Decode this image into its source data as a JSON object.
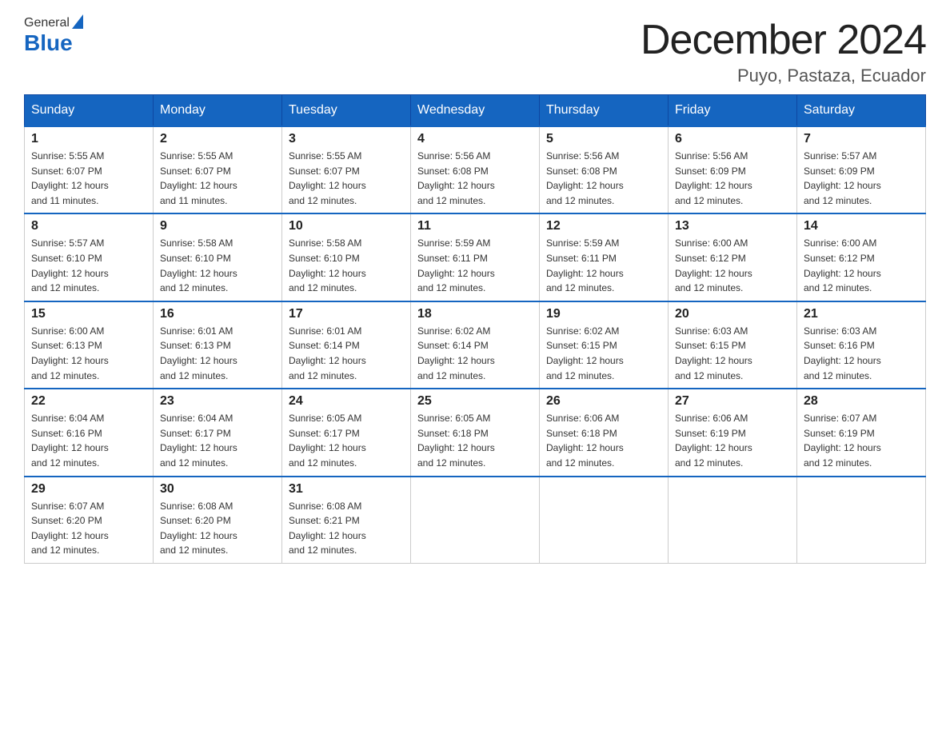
{
  "logo": {
    "general": "General",
    "blue": "Blue"
  },
  "title": "December 2024",
  "location": "Puyo, Pastaza, Ecuador",
  "days_of_week": [
    "Sunday",
    "Monday",
    "Tuesday",
    "Wednesday",
    "Thursday",
    "Friday",
    "Saturday"
  ],
  "weeks": [
    [
      {
        "day": "1",
        "sunrise": "5:55 AM",
        "sunset": "6:07 PM",
        "daylight": "12 hours and 11 minutes."
      },
      {
        "day": "2",
        "sunrise": "5:55 AM",
        "sunset": "6:07 PM",
        "daylight": "12 hours and 11 minutes."
      },
      {
        "day": "3",
        "sunrise": "5:55 AM",
        "sunset": "6:07 PM",
        "daylight": "12 hours and 12 minutes."
      },
      {
        "day": "4",
        "sunrise": "5:56 AM",
        "sunset": "6:08 PM",
        "daylight": "12 hours and 12 minutes."
      },
      {
        "day": "5",
        "sunrise": "5:56 AM",
        "sunset": "6:08 PM",
        "daylight": "12 hours and 12 minutes."
      },
      {
        "day": "6",
        "sunrise": "5:56 AM",
        "sunset": "6:09 PM",
        "daylight": "12 hours and 12 minutes."
      },
      {
        "day": "7",
        "sunrise": "5:57 AM",
        "sunset": "6:09 PM",
        "daylight": "12 hours and 12 minutes."
      }
    ],
    [
      {
        "day": "8",
        "sunrise": "5:57 AM",
        "sunset": "6:10 PM",
        "daylight": "12 hours and 12 minutes."
      },
      {
        "day": "9",
        "sunrise": "5:58 AM",
        "sunset": "6:10 PM",
        "daylight": "12 hours and 12 minutes."
      },
      {
        "day": "10",
        "sunrise": "5:58 AM",
        "sunset": "6:10 PM",
        "daylight": "12 hours and 12 minutes."
      },
      {
        "day": "11",
        "sunrise": "5:59 AM",
        "sunset": "6:11 PM",
        "daylight": "12 hours and 12 minutes."
      },
      {
        "day": "12",
        "sunrise": "5:59 AM",
        "sunset": "6:11 PM",
        "daylight": "12 hours and 12 minutes."
      },
      {
        "day": "13",
        "sunrise": "6:00 AM",
        "sunset": "6:12 PM",
        "daylight": "12 hours and 12 minutes."
      },
      {
        "day": "14",
        "sunrise": "6:00 AM",
        "sunset": "6:12 PM",
        "daylight": "12 hours and 12 minutes."
      }
    ],
    [
      {
        "day": "15",
        "sunrise": "6:00 AM",
        "sunset": "6:13 PM",
        "daylight": "12 hours and 12 minutes."
      },
      {
        "day": "16",
        "sunrise": "6:01 AM",
        "sunset": "6:13 PM",
        "daylight": "12 hours and 12 minutes."
      },
      {
        "day": "17",
        "sunrise": "6:01 AM",
        "sunset": "6:14 PM",
        "daylight": "12 hours and 12 minutes."
      },
      {
        "day": "18",
        "sunrise": "6:02 AM",
        "sunset": "6:14 PM",
        "daylight": "12 hours and 12 minutes."
      },
      {
        "day": "19",
        "sunrise": "6:02 AM",
        "sunset": "6:15 PM",
        "daylight": "12 hours and 12 minutes."
      },
      {
        "day": "20",
        "sunrise": "6:03 AM",
        "sunset": "6:15 PM",
        "daylight": "12 hours and 12 minutes."
      },
      {
        "day": "21",
        "sunrise": "6:03 AM",
        "sunset": "6:16 PM",
        "daylight": "12 hours and 12 minutes."
      }
    ],
    [
      {
        "day": "22",
        "sunrise": "6:04 AM",
        "sunset": "6:16 PM",
        "daylight": "12 hours and 12 minutes."
      },
      {
        "day": "23",
        "sunrise": "6:04 AM",
        "sunset": "6:17 PM",
        "daylight": "12 hours and 12 minutes."
      },
      {
        "day": "24",
        "sunrise": "6:05 AM",
        "sunset": "6:17 PM",
        "daylight": "12 hours and 12 minutes."
      },
      {
        "day": "25",
        "sunrise": "6:05 AM",
        "sunset": "6:18 PM",
        "daylight": "12 hours and 12 minutes."
      },
      {
        "day": "26",
        "sunrise": "6:06 AM",
        "sunset": "6:18 PM",
        "daylight": "12 hours and 12 minutes."
      },
      {
        "day": "27",
        "sunrise": "6:06 AM",
        "sunset": "6:19 PM",
        "daylight": "12 hours and 12 minutes."
      },
      {
        "day": "28",
        "sunrise": "6:07 AM",
        "sunset": "6:19 PM",
        "daylight": "12 hours and 12 minutes."
      }
    ],
    [
      {
        "day": "29",
        "sunrise": "6:07 AM",
        "sunset": "6:20 PM",
        "daylight": "12 hours and 12 minutes."
      },
      {
        "day": "30",
        "sunrise": "6:08 AM",
        "sunset": "6:20 PM",
        "daylight": "12 hours and 12 minutes."
      },
      {
        "day": "31",
        "sunrise": "6:08 AM",
        "sunset": "6:21 PM",
        "daylight": "12 hours and 12 minutes."
      },
      null,
      null,
      null,
      null
    ]
  ],
  "labels": {
    "sunrise": "Sunrise:",
    "sunset": "Sunset:",
    "daylight": "Daylight:"
  }
}
